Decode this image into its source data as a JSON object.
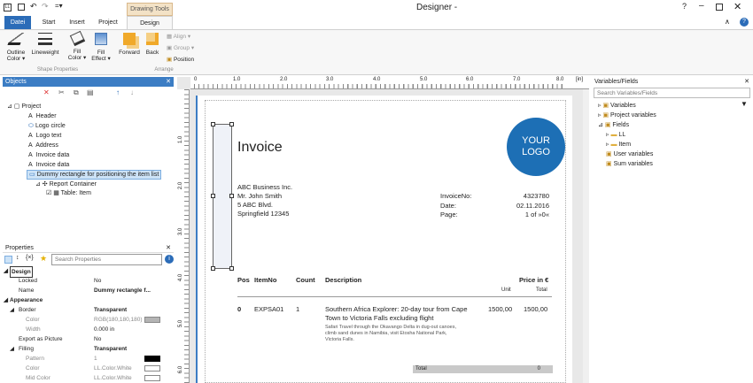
{
  "window": {
    "title": "Designer -"
  },
  "ribbon": {
    "tabs": [
      "Datei",
      "Start",
      "Insert",
      "Project",
      "Design"
    ],
    "contextual": "Drawing Tools",
    "buttons": {
      "outline_color": "Outline Color ▾",
      "lineweight": "Lineweight",
      "fill_color": "Fill Color ▾",
      "fill_effect": "Fill Effect ▾",
      "forward": "Forward",
      "back": "Back",
      "align": "Align ▾",
      "group": "Group ▾",
      "position": "Position"
    },
    "groups": {
      "shape_properties": "Shape Properties",
      "arrange": "Arrange"
    }
  },
  "objects_panel": {
    "title": "Objects",
    "tree": [
      "Project",
      "Header",
      "Logo circle",
      "Logo text",
      "Address",
      "Invoice data",
      "Invoice data",
      "Dummy rectangle for positioning the item list",
      "Report Container",
      "Table: Item"
    ]
  },
  "properties_panel": {
    "title": "Properties",
    "search_placeholder": "Search Properties",
    "rows": [
      {
        "k": "Design",
        "v": ""
      },
      {
        "k": "Locked",
        "v": "No"
      },
      {
        "k": "Name",
        "v": "Dummy rectangle f..."
      },
      {
        "k": "Appearance",
        "v": ""
      },
      {
        "k": "Border",
        "v": "Transparent"
      },
      {
        "k": "Color",
        "v": "RGB(180,180,180)"
      },
      {
        "k": "Width",
        "v": "0.000 in"
      },
      {
        "k": "Export as Picture",
        "v": "No"
      },
      {
        "k": "Filling",
        "v": "Transparent"
      },
      {
        "k": "Pattern",
        "v": "1"
      },
      {
        "k": "Color",
        "v": "LL.Color.White"
      },
      {
        "k": "Mid Color",
        "v": "LL.Color.White"
      }
    ]
  },
  "ruler": {
    "ticks": [
      "0",
      "1.0",
      "2.0",
      "3.0",
      "4.0",
      "5.0",
      "6.0",
      "7.0",
      "8.0"
    ],
    "unit": "[in]",
    "vticks": [
      "1.0",
      "2.0",
      "3.0",
      "4.0",
      "5.0",
      "6.0"
    ]
  },
  "invoice": {
    "title": "Invoice",
    "logo": [
      "YOUR",
      "LOGO"
    ],
    "address": [
      "ABC Business Inc.",
      "Mr. John Smith",
      "5 ABC Blvd.",
      "Springfield 12345"
    ],
    "meta_labels": [
      "InvoiceNo:",
      "Date:",
      "Page:"
    ],
    "meta_values": [
      "4323780",
      "02.11.2016",
      "1 of »0«"
    ],
    "headers": {
      "pos": "Pos",
      "itemno": "ItemNo",
      "count": "Count",
      "desc": "Description",
      "price": "Price in €",
      "unit": "Unit",
      "total": "Total"
    },
    "row": {
      "pos": "0",
      "itemno": "EXPSA01",
      "count": "1",
      "desc1": "Southern Africa Explorer: 20-day tour from Cape",
      "desc2": "Town to Victoria Falls excluding flight",
      "sub1": "Safari Travel through the Okavango Delta in dug-out canoes,",
      "sub2": "climb sand dunes in Namibia, visit Etosha National Park,",
      "sub3": "Victoria Falls.",
      "unit": "1500,00",
      "total": "1500,00"
    },
    "total_label": "Total",
    "total_value": "0"
  },
  "vars_panel": {
    "title": "Variables/Fields",
    "search_placeholder": "Search Variables/Fields",
    "tree": [
      "Variables",
      "Project variables",
      "Fields",
      "LL",
      "Item",
      "User variables",
      "Sum variables"
    ]
  }
}
